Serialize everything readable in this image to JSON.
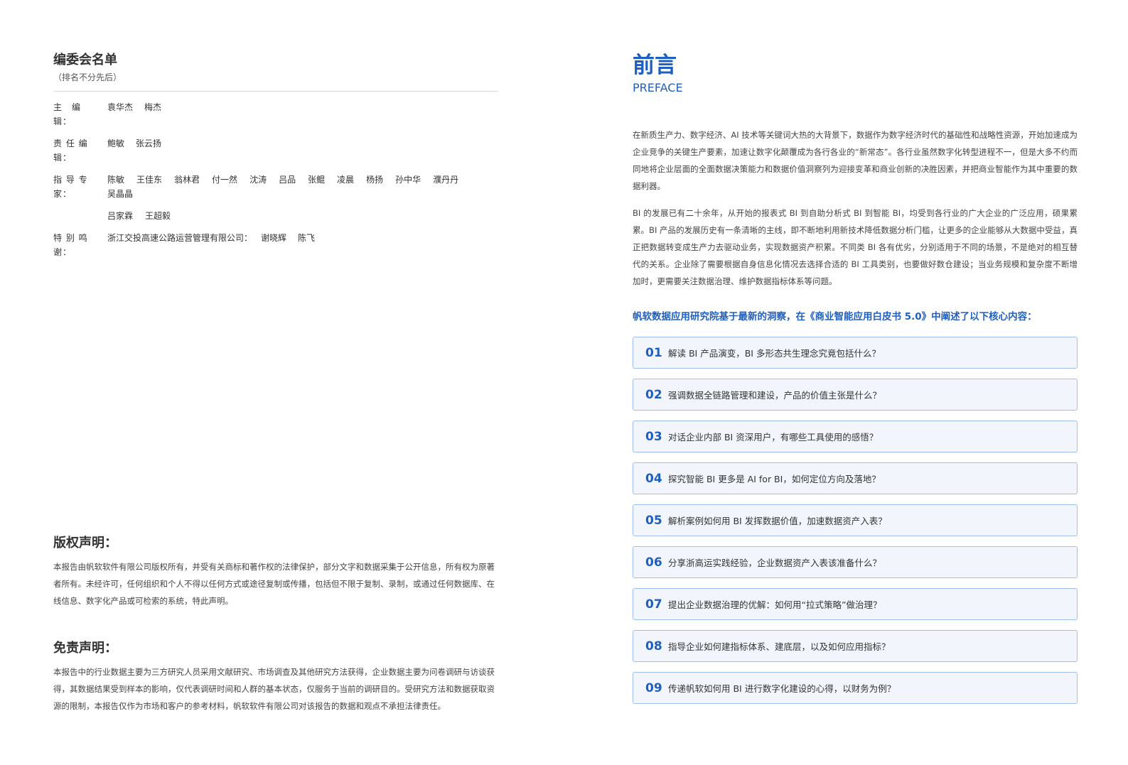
{
  "editorial": {
    "title": "编委会名单",
    "subtitle": "（排名不分先后）",
    "rows": [
      {
        "role": "主　编　辑：",
        "names": [
          "袁华杰",
          "梅杰"
        ]
      },
      {
        "role": "责 任 编 辑：",
        "names": [
          "鲍敏",
          "张云扬"
        ]
      },
      {
        "role": "指 导 专 家：",
        "names": [
          "陈敏",
          "王佳东",
          "翁林君",
          "付一然",
          "沈涛",
          "吕品",
          "张鲲",
          "凌晨",
          "杨扬",
          "孙中华",
          "濮丹丹",
          "吴晶晶"
        ],
        "names2": [
          "吕家霖",
          "王超毅"
        ]
      },
      {
        "role": "特 别 鸣 谢：",
        "names": [
          "浙江交投高速公路运营管理有限公司：",
          "谢晓辉",
          "陈飞"
        ]
      }
    ]
  },
  "copyright": {
    "title": "版权声明：",
    "body": "本报告由帆软软件有限公司版权所有，并受有关商标和著作权的法律保护，部分文字和数据采集于公开信息，所有权为原著者所有。未经许可，任何组织和个人不得以任何方式或途径复制或传播，包括但不限于复制、录制，或通过任何数据库、在线信息、数字化产品或可检索的系统，特此声明。"
  },
  "disclaimer": {
    "title": "免责声明：",
    "body": "本报告中的行业数据主要为三方研究人员采用文献研究、市场调查及其他研究方法获得，企业数据主要为问卷调研与访谈获得，其数据结果受到样本的影响，仅代表调研时间和人群的基本状态，仅服务于当前的调研目的。受研究方法和数据获取资源的限制，本报告仅作为市场和客户的参考材料，帆软软件有限公司对该报告的数据和观点不承担法律责任。"
  },
  "preface": {
    "title": "前言",
    "subtitle": "PREFACE",
    "para1": "在新质生产力、数字经济、AI 技术等关键词大热的大背景下，数据作为数字经济时代的基础性和战略性资源，开始加速成为企业竞争的关键生产要素，加速让数字化颠覆成为各行各业的“新常态”。各行业虽然数字化转型进程不一，但是大多不约而同地将企业层面的全面数据决策能力和数据价值洞察列为迎接变革和商业创新的决胜因素，并把商业智能作为其中重要的数据利器。",
    "para2": "BI 的发展已有二十余年，从开始的报表式 BI 到自助分析式 BI 到智能 BI，均受到各行业的广大企业的广泛应用，硕果累累。BI 产品的发展历史有一条清晰的主线，即不断地利用新技术降低数据分析门槛，让更多的企业能够从大数据中受益，真正把数据转变成生产力去驱动业务，实现数据资产积累。不同类 BI 各有优劣，分别适用于不同的场景，不是绝对的相互替代的关系。企业除了需要根据自身信息化情况去选择合适的 BI 工具类别，也要做好数仓建设；当业务规模和复杂度不断增加时，更需要关注数据治理、维护数据指标体系等问题。",
    "lead": "帆软数据应用研究院基于最新的洞察，在《商业智能应用白皮书 5.0》中阐述了以下核心内容：",
    "items": [
      {
        "num": "01",
        "text": "解读 BI 产品演变，BI 多形态共生理念究竟包括什么？"
      },
      {
        "num": "02",
        "text": "强调数据全链路管理和建设，产品的价值主张是什么？"
      },
      {
        "num": "03",
        "text": "对话企业内部 BI 资深用户，有哪些工具使用的感悟？"
      },
      {
        "num": "04",
        "text": "探究智能 BI 更多是 AI for BI，如何定位方向及落地？"
      },
      {
        "num": "05",
        "text": "解析案例如何用 BI 发挥数据价值，加速数据资产入表？"
      },
      {
        "num": "06",
        "text": "分享浙高运实践经验，企业数据资产入表该准备什么？"
      },
      {
        "num": "07",
        "text": "提出企业数据治理的优解：如何用“拉式策略”做治理？"
      },
      {
        "num": "08",
        "text": "指导企业如何建指标体系、建底层，以及如何应用指标？"
      },
      {
        "num": "09",
        "text": "传递帆软如何用 BI 进行数字化建设的心得，以财务为例？"
      }
    ]
  }
}
